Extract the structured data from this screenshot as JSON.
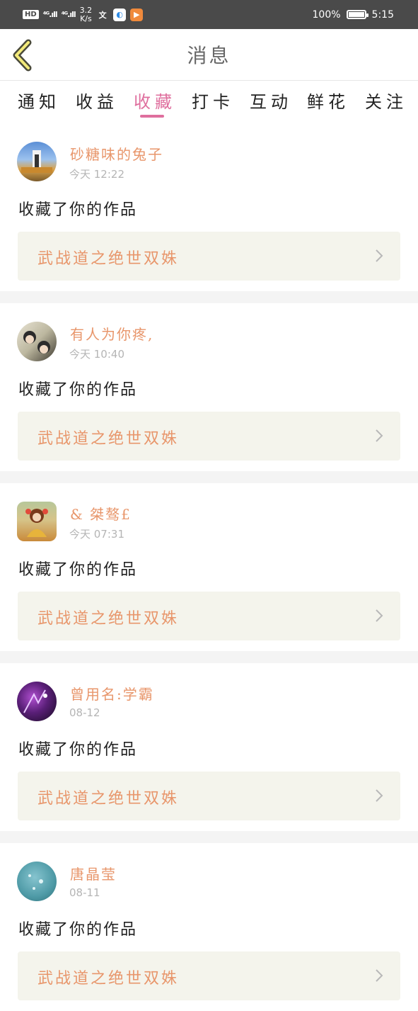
{
  "status_bar": {
    "hd": "HD",
    "sig1": "⁴ᴳ.ıll",
    "sig2": "⁴ᴳ.ıll",
    "speed_value": "3.2",
    "speed_unit": "K/s",
    "app1": "文",
    "app2": "◐",
    "app3": "▶",
    "battery_text": "100%",
    "battery_level": 1.0,
    "time": "5:15"
  },
  "header": {
    "title": "消息"
  },
  "tabs": [
    {
      "label": "通知"
    },
    {
      "label": "收益"
    },
    {
      "label": "收藏"
    },
    {
      "label": "打卡"
    },
    {
      "label": "互动"
    },
    {
      "label": "鲜花"
    },
    {
      "label": "关注"
    }
  ],
  "active_tab": "收藏",
  "colors": {
    "accent": "#df6f9e",
    "name": "#e8966b",
    "card_bg": "#f4f4ec"
  },
  "messages": [
    {
      "name": "砂糖味的兔子",
      "time": "今天 12:22",
      "action": "收藏了你的作品",
      "work": "武战道之绝世双姝"
    },
    {
      "name": "有人为你疼,",
      "time": "今天 10:40",
      "action": "收藏了你的作品",
      "work": "武战道之绝世双姝"
    },
    {
      "name": "& 桀骜£",
      "time": "今天 07:31",
      "action": "收藏了你的作品",
      "work": "武战道之绝世双姝"
    },
    {
      "name": "曾用名:学霸",
      "time": "08-12",
      "action": "收藏了你的作品",
      "work": "武战道之绝世双姝"
    },
    {
      "name": "唐晶莹",
      "time": "08-11",
      "action": "收藏了你的作品",
      "work": "武战道之绝世双姝"
    }
  ]
}
